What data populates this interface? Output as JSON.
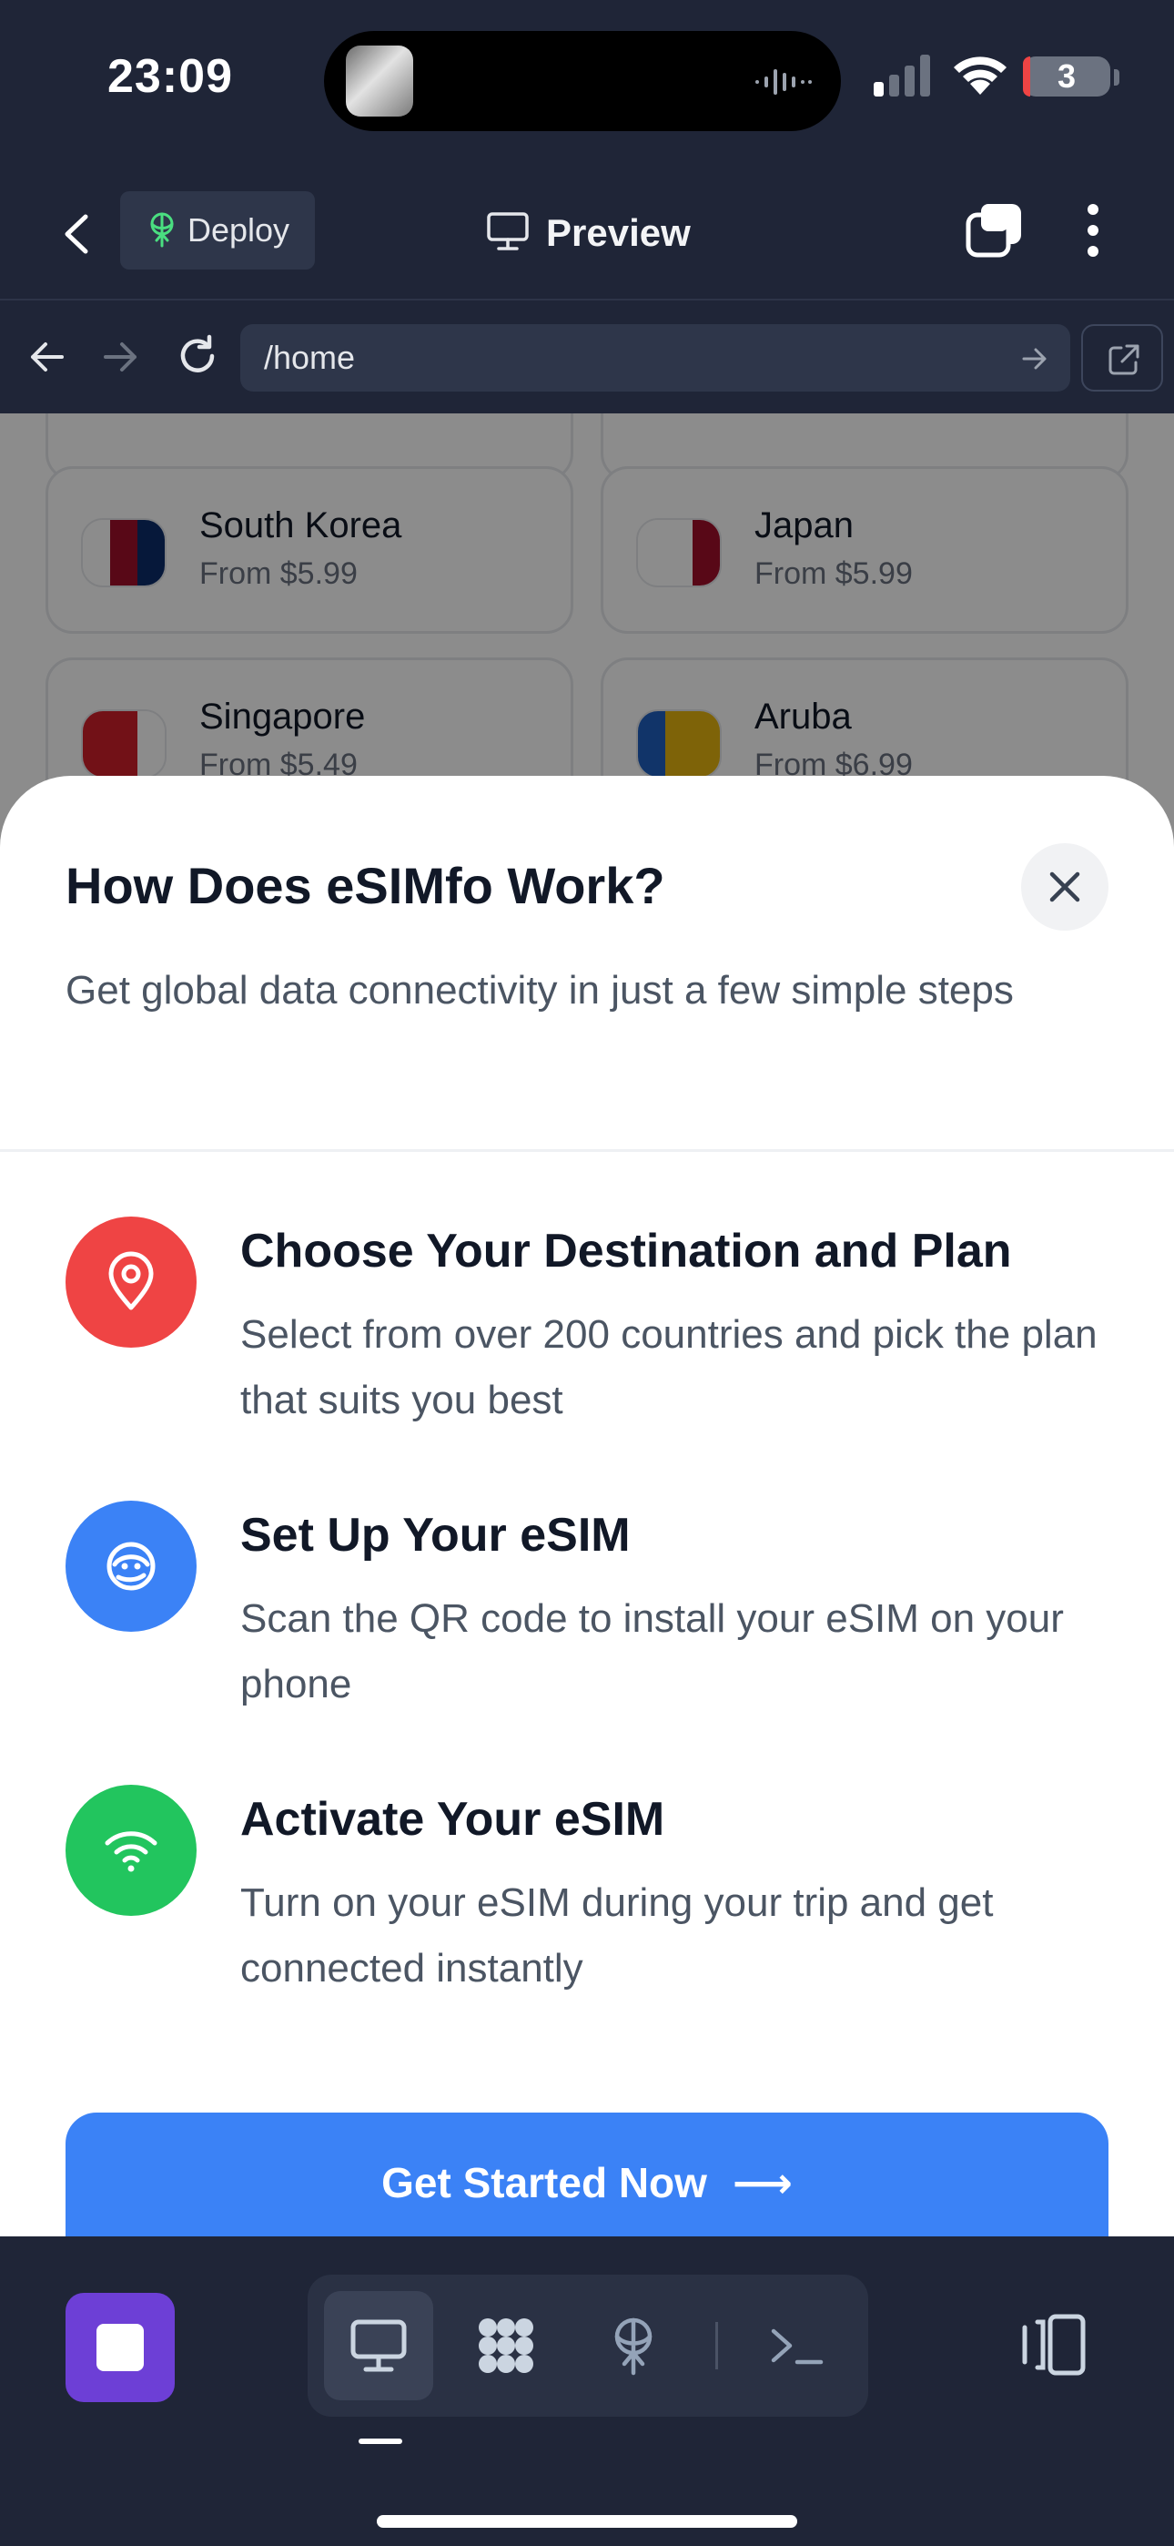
{
  "status_bar": {
    "time": "23:09",
    "battery": "3"
  },
  "app_bar": {
    "deploy_label": "Deploy",
    "preview_label": "Preview"
  },
  "browser": {
    "url": "/home"
  },
  "web": {
    "cards": [
      {
        "name": "South Korea",
        "price": "From $5.99",
        "flag_colors": [
          "#ffffff",
          "#a0102a",
          "#0b2d6b"
        ]
      },
      {
        "name": "Japan",
        "price": "From $5.99",
        "flag_colors": [
          "#ffffff",
          "#ffffff",
          "#a0102a"
        ]
      },
      {
        "name": "Singapore",
        "price": "From $5.49",
        "flag_colors": [
          "#d0202a",
          "#d0202a",
          "#ffffff"
        ]
      },
      {
        "name": "Aruba",
        "price": "From $6.99",
        "flag_colors": [
          "#1f5fbf",
          "#e6b410",
          "#e6b410"
        ]
      }
    ]
  },
  "sheet": {
    "title": "How Does eSIMfo Work?",
    "subtitle": "Get global data connectivity in just a few simple steps",
    "steps": [
      {
        "icon": "map-pin-icon",
        "color": "#ef4444",
        "title": "Choose Your Destination and Plan",
        "desc": "Select from over 200 countries and pick the plan that suits you best"
      },
      {
        "icon": "chat-icon",
        "color": "#3b82f6",
        "title": "Set Up Your eSIM",
        "desc": "Scan the QR code to install your eSIM on your phone"
      },
      {
        "icon": "wifi-icon",
        "color": "#22c55e",
        "title": "Activate Your eSIM",
        "desc": "Turn on your eSIM during your trip and get connected instantly"
      }
    ],
    "cta_label": "Get Started Now",
    "cta_arrow": "⟶"
  },
  "colors": {
    "background": "#1f2537",
    "accent": "#3b82f6",
    "stop": "#6d3fd6"
  }
}
